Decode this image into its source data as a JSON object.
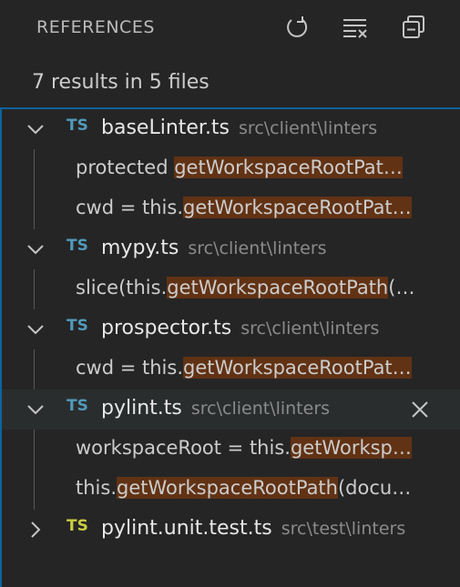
{
  "header": {
    "title": "REFERENCES",
    "actions": [
      {
        "name": "refresh-icon"
      },
      {
        "name": "clear-all-icon"
      },
      {
        "name": "collapse-all-icon"
      }
    ]
  },
  "summary": "7 results in 5 files",
  "files": [
    {
      "icon": "TS",
      "name": "baseLinter.ts",
      "dir": "src\\client\\linters",
      "expanded": true,
      "matches": [
        {
          "before": "protected ",
          "match": "getWorkspaceRootPat…",
          "after": ""
        },
        {
          "before": "cwd = this.",
          "match": "getWorkspaceRootPat…",
          "after": ""
        }
      ]
    },
    {
      "icon": "TS",
      "name": "mypy.ts",
      "dir": "src\\client\\linters",
      "expanded": true,
      "matches": [
        {
          "before": "slice(this.",
          "match": "getWorkspaceRootPath",
          "after": "(…"
        }
      ]
    },
    {
      "icon": "TS",
      "name": "prospector.ts",
      "dir": "src\\client\\linters",
      "expanded": true,
      "matches": [
        {
          "before": "cwd = this.",
          "match": "getWorkspaceRootPat…",
          "after": ""
        }
      ]
    },
    {
      "icon": "TS",
      "name": "pylint.ts",
      "dir": "src\\client\\linters",
      "expanded": true,
      "matches": [
        {
          "before": "workspaceRoot = this.",
          "match": "getWorksp…",
          "after": ""
        },
        {
          "before": "this.",
          "match": "getWorkspaceRootPath",
          "after": "(docu…"
        }
      ]
    },
    {
      "icon": "TS",
      "name": "pylint.unit.test.ts",
      "dir": "src\\test\\linters",
      "expanded": false,
      "matches": []
    }
  ],
  "colors": {
    "background": "#252526",
    "accent_border": "#0e639c",
    "match_highlight": "#613214",
    "ts_icon": "#519aba",
    "ts_test_icon": "#cbcb41"
  }
}
